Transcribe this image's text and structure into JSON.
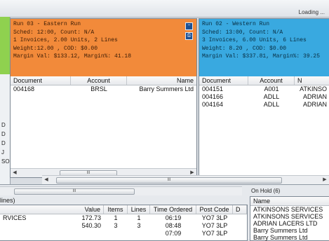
{
  "loading_text": "Loading ...",
  "left_stubs": [
    "D",
    "D",
    "D",
    "J",
    "SON"
  ],
  "east": {
    "header_lines": [
      "Run 03  - Eastern Run",
      "Sched: 12:00, Count: N/A",
      "1   Invoices, 2.00  Units, 2   Lines",
      "Weight:12.00 , COD: $0.00",
      "Margin Val: $133.12, Margin%:  41.18"
    ],
    "columns": [
      "Document",
      "Account",
      "Name"
    ],
    "rows": [
      [
        "004168",
        "BRSL",
        "Barry Summers Ltd"
      ]
    ],
    "scroll_label": "III"
  },
  "west": {
    "header_lines": [
      "Run 02  - Western Run",
      "Sched: 13:00, Count: N/A",
      "3   Invoices, 6.00  Units, 6   Lines",
      "Weight: 8.20 , COD: $0.00",
      "Margin Val: $337.81, Margin%:  39.25"
    ],
    "columns": [
      "Document",
      "Account",
      "N"
    ],
    "rows": [
      [
        "004151",
        "A001",
        "ATKINSO"
      ],
      [
        "004166",
        "ADLL",
        "ADRIAN"
      ],
      [
        "004164",
        "ADLL",
        "ADRIAN"
      ]
    ]
  },
  "main_scroll_label": "III",
  "bottom": {
    "lines_tab": "lines)",
    "scroll_label": "III",
    "columns": [
      "Value",
      "Items",
      "Lines",
      "Time Ordered",
      "Post Code",
      "D"
    ],
    "rows": [
      {
        "name": "RVICES",
        "value": "172.73",
        "items": "1",
        "lines": "1",
        "time": "06:19",
        "post": "YO7 3LP"
      },
      {
        "name": "",
        "value": "540.30",
        "items": "3",
        "lines": "3",
        "time": "08:48",
        "post": "YO7 3LP"
      },
      {
        "name": "",
        "value": "",
        "items": "",
        "lines": "",
        "time": "07:09",
        "post": "YO7 3LP"
      }
    ]
  },
  "on_hold": {
    "title": "On Hold (6)",
    "column": "Name",
    "items": [
      "ATKINSONS SERVICES",
      "ATKINSONS SERVICES",
      "ADRIAN LACERS LTD",
      "Barry Summers Ltd",
      "Barry Summers Ltd"
    ]
  }
}
